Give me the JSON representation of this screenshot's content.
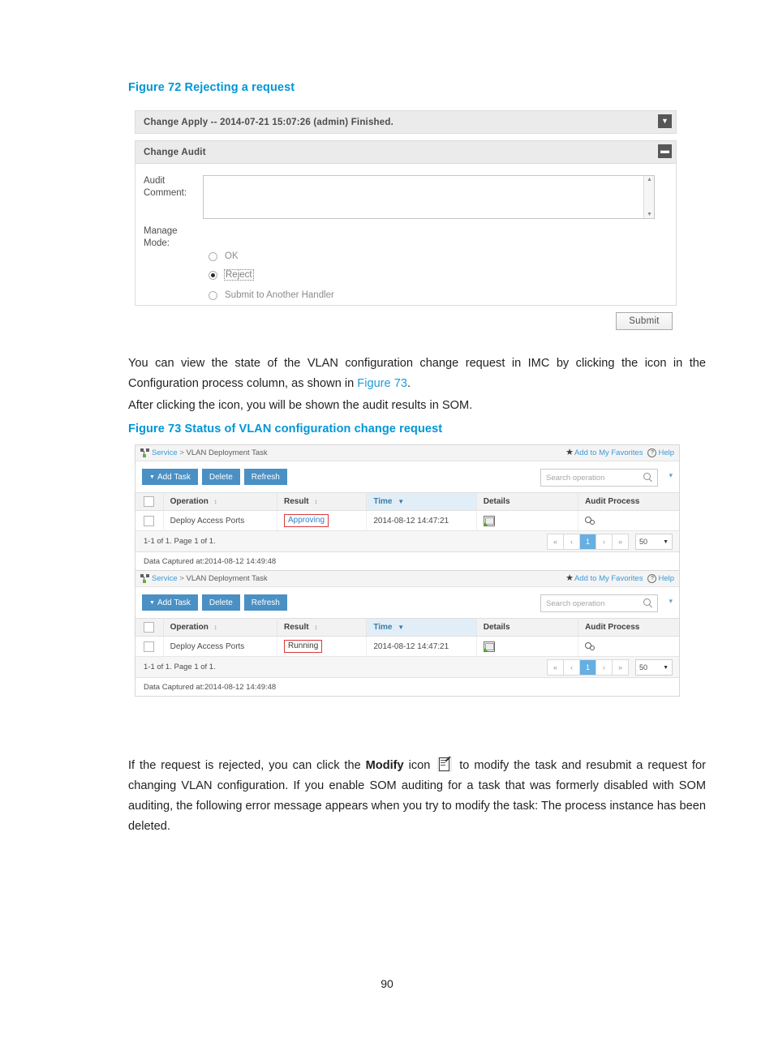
{
  "document": {
    "page_number": "90"
  },
  "figure72": {
    "caption": "Figure 72 Rejecting a request",
    "change_apply_title": "Change Apply -- 2014-07-21 15:07:26 (admin) Finished.",
    "change_apply_toggle_icon": "chevron-down-icon",
    "change_audit_title": "Change Audit",
    "change_audit_toggle_icon": "minus-icon",
    "audit_comment_label": "Audit\nComment:",
    "audit_comment_label_line1": "Audit",
    "audit_comment_label_line2": "Comment:",
    "audit_comment_value": "",
    "manage_mode_label_line1": "Manage",
    "manage_mode_label_line2": "Mode:",
    "manage_mode_options": [
      {
        "label": "OK",
        "selected": false
      },
      {
        "label": "Reject",
        "selected": true
      },
      {
        "label": "Submit to Another Handler",
        "selected": false
      }
    ],
    "submit_label": "Submit"
  },
  "body": {
    "para1_part1": "You can view the state of the VLAN configuration change request in IMC by clicking the icon in the Configuration process column, as shown in ",
    "para1_link": "Figure 73",
    "para1_part2": ".",
    "para2": "After clicking the icon, you will be shown the audit results in SOM.",
    "para3_part1": "If the request is rejected, you can click the ",
    "para3_bold": "Modify",
    "para3_part2": " icon ",
    "para3_icon": "modify-icon",
    "para3_part3": " to modify the task and resubmit a request for changing VLAN configuration. If you enable SOM auditing for a task that was formerly disabled with SOM auditing, the following error message appears when you try to modify the task: The process instance has been deleted."
  },
  "figure73": {
    "caption": "Figure 73 Status of VLAN configuration change request",
    "widgets": [
      {
        "breadcrumb_root": "Service",
        "breadcrumb_sep": ">",
        "breadcrumb_current": "VLAN Deployment Task",
        "favorites_label": "Add to My Favorites",
        "help_label": "Help",
        "buttons": [
          {
            "label": "Add Task",
            "has_caret": true
          },
          {
            "label": "Delete",
            "has_caret": false
          },
          {
            "label": "Refresh",
            "has_caret": false
          }
        ],
        "search_placeholder": "Search operation",
        "columns": [
          "Operation",
          "Result",
          "Time",
          "Details",
          "Audit Process"
        ],
        "sorted_column": "Time",
        "rows": [
          {
            "operation": "Deploy Access Ports",
            "result": "Approving",
            "result_style": "link",
            "time": "2014-08-12 14:47:21",
            "details_icon": "details-window-icon",
            "audit_process_icon": "gears-icon"
          }
        ],
        "pagination_summary": "1-1 of 1. Page 1 of 1.",
        "pagination_first": "«",
        "pagination_prev": "‹",
        "pagination_current": "1",
        "pagination_next": "›",
        "pagination_last": "»",
        "page_size": "50",
        "captured_text": "Data Captured at:2014-08-12 14:49:48"
      },
      {
        "breadcrumb_root": "Service",
        "breadcrumb_sep": ">",
        "breadcrumb_current": "VLAN Deployment Task",
        "favorites_label": "Add to My Favorites",
        "help_label": "Help",
        "buttons": [
          {
            "label": "Add Task",
            "has_caret": true
          },
          {
            "label": "Delete",
            "has_caret": false
          },
          {
            "label": "Refresh",
            "has_caret": false
          }
        ],
        "search_placeholder": "Search operation",
        "columns": [
          "Operation",
          "Result",
          "Time",
          "Details",
          "Audit Process"
        ],
        "sorted_column": "Time",
        "rows": [
          {
            "operation": "Deploy Access Ports",
            "result": "Running",
            "result_style": "dark",
            "time": "2014-08-12 14:47:21",
            "details_icon": "details-window-icon",
            "audit_process_icon": "gears-icon"
          }
        ],
        "pagination_summary": "1-1 of 1. Page 1 of 1.",
        "pagination_first": "«",
        "pagination_prev": "‹",
        "pagination_current": "1",
        "pagination_next": "›",
        "pagination_last": "»",
        "page_size": "50",
        "captured_text": "Data Captured at:2014-08-12 14:49:48"
      }
    ]
  },
  "colors": {
    "caption_blue": "#0096d6",
    "link_blue": "#1f9cd8",
    "button_blue": "#4a90c4",
    "annotation_red": "#d93a3a",
    "pager_active": "#66afe0"
  }
}
